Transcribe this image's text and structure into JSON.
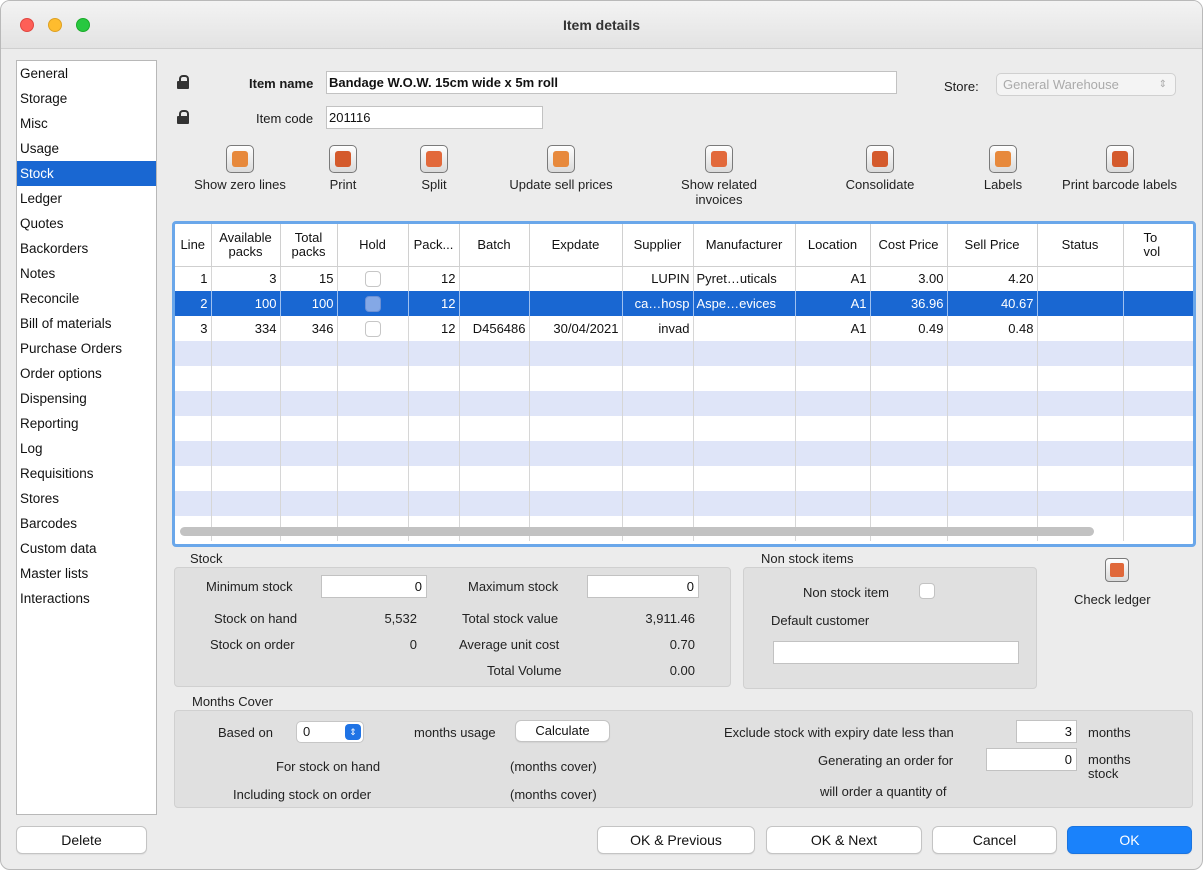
{
  "window": {
    "title": "Item details"
  },
  "sidebar": {
    "items": [
      {
        "label": "General"
      },
      {
        "label": "Storage"
      },
      {
        "label": "Misc"
      },
      {
        "label": "Usage"
      },
      {
        "label": "Stock",
        "active": true
      },
      {
        "label": "Ledger"
      },
      {
        "label": "Quotes"
      },
      {
        "label": "Backorders"
      },
      {
        "label": "Notes"
      },
      {
        "label": "Reconcile"
      },
      {
        "label": "Bill of materials"
      },
      {
        "label": "Purchase Orders"
      },
      {
        "label": "Order options"
      },
      {
        "label": "Dispensing"
      },
      {
        "label": "Reporting"
      },
      {
        "label": "Log"
      },
      {
        "label": "Requisitions"
      },
      {
        "label": "Stores"
      },
      {
        "label": "Barcodes"
      },
      {
        "label": "Custom data"
      },
      {
        "label": "Master lists"
      },
      {
        "label": "Interactions"
      }
    ]
  },
  "header": {
    "item_name_label": "Item name",
    "item_name_value": "Bandage W.O.W. 15cm wide x 5m roll",
    "item_code_label": "Item code",
    "item_code_value": "201116",
    "store_label": "Store:",
    "store_value": "General Warehouse"
  },
  "toolbar": {
    "show_zero_lines": "Show zero lines",
    "print": "Print",
    "split": "Split",
    "update_sell_prices": "Update sell prices",
    "show_related_invoices_1": "Show related",
    "show_related_invoices_2": "invoices",
    "consolidate": "Consolidate",
    "labels": "Labels",
    "print_barcode_labels": "Print barcode labels"
  },
  "table": {
    "columns": {
      "line": "Line",
      "available_1": "Available",
      "available_2": "packs",
      "total_1": "Total",
      "total_2": "packs",
      "hold": "Hold",
      "pack": "Pack...",
      "batch": "Batch",
      "expdate": "Expdate",
      "supplier": "Supplier",
      "manufacturer": "Manufacturer",
      "location": "Location",
      "cost_price": "Cost Price",
      "sell_price": "Sell Price",
      "status": "Status",
      "total_vol_1": "To",
      "total_vol_2": "vol"
    },
    "rows": [
      {
        "line": "1",
        "available": "3",
        "total": "15",
        "hold": false,
        "pack": "12",
        "batch": "",
        "expdate": "",
        "supplier": "LUPIN",
        "manufacturer": "Pyret…uticals",
        "location": "A1",
        "cost_price": "3.00",
        "sell_price": "4.20",
        "status": ""
      },
      {
        "line": "2",
        "available": "100",
        "total": "100",
        "hold": true,
        "pack": "12",
        "batch": "",
        "expdate": "",
        "supplier": "ca…hosp",
        "manufacturer": "Aspe…evices",
        "location": "A1",
        "cost_price": "36.96",
        "sell_price": "40.67",
        "status": ""
      },
      {
        "line": "3",
        "available": "334",
        "total": "346",
        "hold": false,
        "pack": "12",
        "batch": "D456486",
        "expdate": "30/04/2021",
        "supplier": "invad",
        "manufacturer": "",
        "location": "A1",
        "cost_price": "0.49",
        "sell_price": "0.48",
        "status": ""
      }
    ],
    "selected_row": 1
  },
  "stock": {
    "title": "Stock",
    "minimum_stock_label": "Minimum stock",
    "minimum_stock_value": "0",
    "maximum_stock_label": "Maximum stock",
    "maximum_stock_value": "0",
    "stock_on_hand_label": "Stock on hand",
    "stock_on_hand_value": "5,532",
    "total_stock_value_label": "Total stock value",
    "total_stock_value_value": "3,911.46",
    "stock_on_order_label": "Stock on order",
    "stock_on_order_value": "0",
    "average_unit_cost_label": "Average unit cost",
    "average_unit_cost_value": "0.70",
    "total_volume_label": "Total Volume",
    "total_volume_value": "0.00"
  },
  "non_stock": {
    "title": "Non stock items",
    "non_stock_item_label": "Non stock item",
    "default_customer_label": "Default customer",
    "default_customer_value": ""
  },
  "check_ledger": {
    "label": "Check ledger"
  },
  "months_cover": {
    "title": "Months Cover",
    "based_on_label": "Based on",
    "based_on_value": "0",
    "months_usage_label": "months usage",
    "calculate_label": "Calculate",
    "for_stock_on_hand_label": "For stock on hand",
    "for_stock_on_hand_value": "(months cover)",
    "including_stock_on_order_label": "Including stock on order",
    "including_stock_on_order_value": "(months cover)",
    "exclude_label": "Exclude stock with expiry date less than",
    "exclude_value": "3",
    "exclude_unit": "months",
    "generating_label": "Generating an order for",
    "generating_value": "0",
    "generating_unit_1": "months",
    "generating_unit_2": "stock",
    "will_order_label": "will order a quantity of"
  },
  "footer": {
    "delete": "Delete",
    "ok_previous": "OK & Previous",
    "ok_next": "OK & Next",
    "cancel": "Cancel",
    "ok": "OK"
  },
  "colors": {
    "accent": "#1967d2",
    "primary_button": "#1a82fb",
    "row_alt": "#dfe5f8",
    "table_focus_border": "#6aa7ea"
  }
}
